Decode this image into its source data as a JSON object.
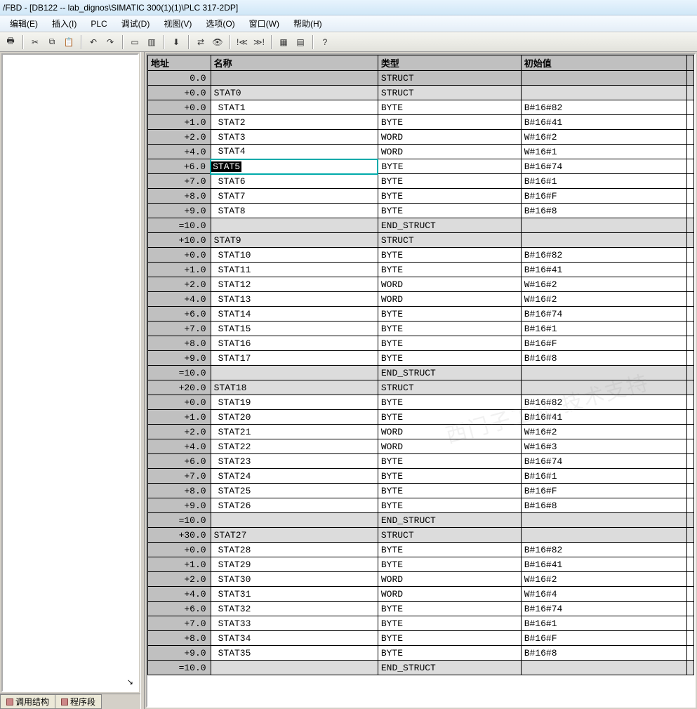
{
  "titleBar": "/FBD  - [DB122 -- lab_dignos\\SIMATIC 300(1)(1)\\PLC 317-2DP]",
  "menus": [
    "编辑(E)",
    "插入(I)",
    "PLC",
    "调试(D)",
    "视图(V)",
    "选项(O)",
    "窗口(W)",
    "帮助(H)"
  ],
  "leftTabs": [
    {
      "label": "调用结构",
      "active": false
    },
    {
      "label": "程序段",
      "active": false
    }
  ],
  "columns": {
    "addr": "地址",
    "name": "名称",
    "type": "类型",
    "init": "初始值"
  },
  "rows": [
    {
      "addr": "0.0",
      "name": "",
      "type": "STRUCT",
      "init": "",
      "cls": "gray",
      "indent": 0
    },
    {
      "addr": "+0.0",
      "name": "STAT0",
      "type": "STRUCT",
      "init": "",
      "cls": "light",
      "indent": 0
    },
    {
      "addr": "+0.0",
      "name": "STAT1",
      "type": "BYTE",
      "init": "B#16#82",
      "cls": "",
      "indent": 1
    },
    {
      "addr": "+1.0",
      "name": "STAT2",
      "type": "BYTE",
      "init": "B#16#41",
      "cls": "",
      "indent": 1
    },
    {
      "addr": "+2.0",
      "name": "STAT3",
      "type": "WORD",
      "init": "W#16#2",
      "cls": "",
      "indent": 1
    },
    {
      "addr": "+4.0",
      "name": "STAT4",
      "type": "WORD",
      "init": "W#16#1",
      "cls": "",
      "indent": 1
    },
    {
      "addr": "+6.0",
      "name": "STAT5",
      "type": "BYTE",
      "init": "B#16#74",
      "cls": "",
      "indent": 1,
      "selected": true
    },
    {
      "addr": "+7.0",
      "name": "STAT6",
      "type": "BYTE",
      "init": "B#16#1",
      "cls": "",
      "indent": 1
    },
    {
      "addr": "+8.0",
      "name": "STAT7",
      "type": "BYTE",
      "init": "B#16#F",
      "cls": "",
      "indent": 1
    },
    {
      "addr": "+9.0",
      "name": "STAT8",
      "type": "BYTE",
      "init": "B#16#8",
      "cls": "",
      "indent": 1
    },
    {
      "addr": "=10.0",
      "name": "",
      "type": "END_STRUCT",
      "init": "",
      "cls": "light",
      "indent": 0
    },
    {
      "addr": "+10.0",
      "name": "STAT9",
      "type": "STRUCT",
      "init": "",
      "cls": "light",
      "indent": 0
    },
    {
      "addr": "+0.0",
      "name": "STAT10",
      "type": "BYTE",
      "init": "B#16#82",
      "cls": "",
      "indent": 1
    },
    {
      "addr": "+1.0",
      "name": "STAT11",
      "type": "BYTE",
      "init": "B#16#41",
      "cls": "",
      "indent": 1
    },
    {
      "addr": "+2.0",
      "name": "STAT12",
      "type": "WORD",
      "init": "W#16#2",
      "cls": "",
      "indent": 1
    },
    {
      "addr": "+4.0",
      "name": "STAT13",
      "type": "WORD",
      "init": "W#16#2",
      "cls": "",
      "indent": 1
    },
    {
      "addr": "+6.0",
      "name": "STAT14",
      "type": "BYTE",
      "init": "B#16#74",
      "cls": "",
      "indent": 1
    },
    {
      "addr": "+7.0",
      "name": "STAT15",
      "type": "BYTE",
      "init": "B#16#1",
      "cls": "",
      "indent": 1
    },
    {
      "addr": "+8.0",
      "name": "STAT16",
      "type": "BYTE",
      "init": "B#16#F",
      "cls": "",
      "indent": 1
    },
    {
      "addr": "+9.0",
      "name": "STAT17",
      "type": "BYTE",
      "init": "B#16#8",
      "cls": "",
      "indent": 1
    },
    {
      "addr": "=10.0",
      "name": "",
      "type": "END_STRUCT",
      "init": "",
      "cls": "light",
      "indent": 0
    },
    {
      "addr": "+20.0",
      "name": "STAT18",
      "type": "STRUCT",
      "init": "",
      "cls": "light",
      "indent": 0
    },
    {
      "addr": "+0.0",
      "name": "STAT19",
      "type": "BYTE",
      "init": "B#16#82",
      "cls": "",
      "indent": 1
    },
    {
      "addr": "+1.0",
      "name": "STAT20",
      "type": "BYTE",
      "init": "B#16#41",
      "cls": "",
      "indent": 1
    },
    {
      "addr": "+2.0",
      "name": "STAT21",
      "type": "WORD",
      "init": "W#16#2",
      "cls": "",
      "indent": 1
    },
    {
      "addr": "+4.0",
      "name": "STAT22",
      "type": "WORD",
      "init": "W#16#3",
      "cls": "",
      "indent": 1
    },
    {
      "addr": "+6.0",
      "name": "STAT23",
      "type": "BYTE",
      "init": "B#16#74",
      "cls": "",
      "indent": 1
    },
    {
      "addr": "+7.0",
      "name": "STAT24",
      "type": "BYTE",
      "init": "B#16#1",
      "cls": "",
      "indent": 1
    },
    {
      "addr": "+8.0",
      "name": "STAT25",
      "type": "BYTE",
      "init": "B#16#F",
      "cls": "",
      "indent": 1
    },
    {
      "addr": "+9.0",
      "name": "STAT26",
      "type": "BYTE",
      "init": "B#16#8",
      "cls": "",
      "indent": 1
    },
    {
      "addr": "=10.0",
      "name": "",
      "type": "END_STRUCT",
      "init": "",
      "cls": "light",
      "indent": 0
    },
    {
      "addr": "+30.0",
      "name": "STAT27",
      "type": "STRUCT",
      "init": "",
      "cls": "light",
      "indent": 0
    },
    {
      "addr": "+0.0",
      "name": "STAT28",
      "type": "BYTE",
      "init": "B#16#82",
      "cls": "",
      "indent": 1
    },
    {
      "addr": "+1.0",
      "name": "STAT29",
      "type": "BYTE",
      "init": "B#16#41",
      "cls": "",
      "indent": 1
    },
    {
      "addr": "+2.0",
      "name": "STAT30",
      "type": "WORD",
      "init": "W#16#2",
      "cls": "",
      "indent": 1
    },
    {
      "addr": "+4.0",
      "name": "STAT31",
      "type": "WORD",
      "init": "W#16#4",
      "cls": "",
      "indent": 1
    },
    {
      "addr": "+6.0",
      "name": "STAT32",
      "type": "BYTE",
      "init": "B#16#74",
      "cls": "",
      "indent": 1
    },
    {
      "addr": "+7.0",
      "name": "STAT33",
      "type": "BYTE",
      "init": "B#16#1",
      "cls": "",
      "indent": 1
    },
    {
      "addr": "+8.0",
      "name": "STAT34",
      "type": "BYTE",
      "init": "B#16#F",
      "cls": "",
      "indent": 1
    },
    {
      "addr": "+9.0",
      "name": "STAT35",
      "type": "BYTE",
      "init": "B#16#8",
      "cls": "",
      "indent": 1
    },
    {
      "addr": "=10.0",
      "name": "",
      "type": "END_STRUCT",
      "init": "",
      "cls": "light",
      "indent": 0
    }
  ],
  "toolbarIcons": [
    "print-icon",
    "sep",
    "cut-icon",
    "copy-icon",
    "paste-icon",
    "sep",
    "undo-icon",
    "redo-icon",
    "sep",
    "window-icon",
    "chart-icon",
    "sep",
    "download-icon",
    "sep",
    "network-icon",
    "monitor-icon",
    "sep",
    "step-icon",
    "run-icon",
    "sep",
    "layout1-icon",
    "layout2-icon",
    "sep",
    "help-icon"
  ],
  "watermark": "西门子工业  技术支持"
}
